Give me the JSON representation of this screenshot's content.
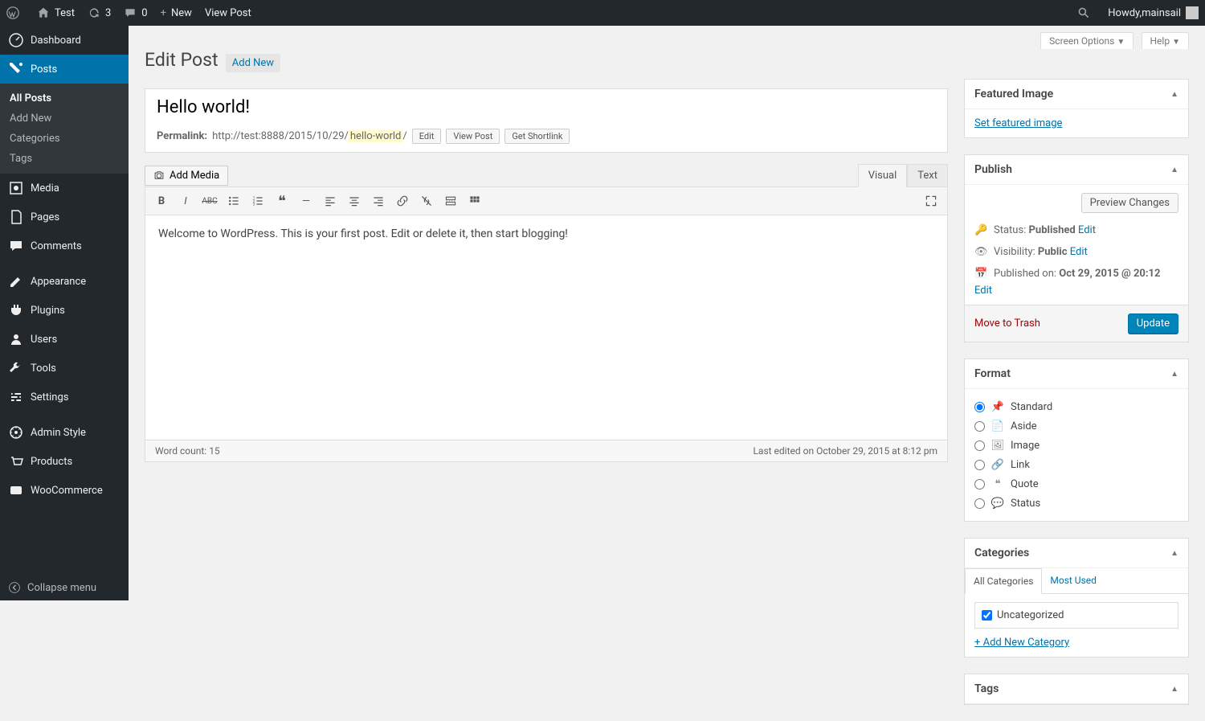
{
  "adminbar": {
    "site_name": "Test",
    "updates_count": "3",
    "comments_count": "0",
    "new_label": "New",
    "view_post": "View Post",
    "howdy_prefix": "Howdy, ",
    "username": "mainsail"
  },
  "menu": {
    "dashboard": "Dashboard",
    "posts": "Posts",
    "posts_sub": {
      "all": "All Posts",
      "add": "Add New",
      "cats": "Categories",
      "tags": "Tags"
    },
    "media": "Media",
    "pages": "Pages",
    "comments": "Comments",
    "appearance": "Appearance",
    "plugins": "Plugins",
    "users": "Users",
    "tools": "Tools",
    "settings": "Settings",
    "admin_style": "Admin Style",
    "products": "Products",
    "woocommerce": "WooCommerce",
    "collapse": "Collapse menu"
  },
  "contextual": {
    "screen_options": "Screen Options",
    "help": "Help"
  },
  "header": {
    "title": "Edit Post",
    "add_new": "Add New"
  },
  "post": {
    "title": "Hello world!",
    "permalink_label": "Permalink:",
    "permalink_base": "http://test:8888/2015/10/29/",
    "slug": "hello-world",
    "permalink_trail": "/",
    "edit_btn": "Edit",
    "view_btn": "View Post",
    "shortlink_btn": "Get Shortlink",
    "content": "Welcome to WordPress. This is your first post. Edit or delete it, then start blogging!"
  },
  "editor": {
    "add_media": "Add Media",
    "tab_visual": "Visual",
    "tab_text": "Text",
    "wordcount_label": "Word count: ",
    "wordcount": "15",
    "last_edited": "Last edited on October 29, 2015 at 8:12 pm"
  },
  "featured": {
    "title": "Featured Image",
    "set_link": "Set featured image"
  },
  "publish": {
    "title": "Publish",
    "preview": "Preview Changes",
    "status_label": "Status: ",
    "status_value": "Published",
    "visibility_label": "Visibility: ",
    "visibility_value": "Public",
    "published_label": "Published on: ",
    "published_value": "Oct 29, 2015 @ 20:12",
    "edit": "Edit",
    "trash": "Move to Trash",
    "update": "Update"
  },
  "format": {
    "title": "Format",
    "options": {
      "standard": "Standard",
      "aside": "Aside",
      "image": "Image",
      "link": "Link",
      "quote": "Quote",
      "status": "Status"
    }
  },
  "categories": {
    "title": "Categories",
    "tab_all": "All Categories",
    "tab_most": "Most Used",
    "uncategorized": "Uncategorized",
    "add_new": "+ Add New Category"
  },
  "tags": {
    "title": "Tags"
  }
}
